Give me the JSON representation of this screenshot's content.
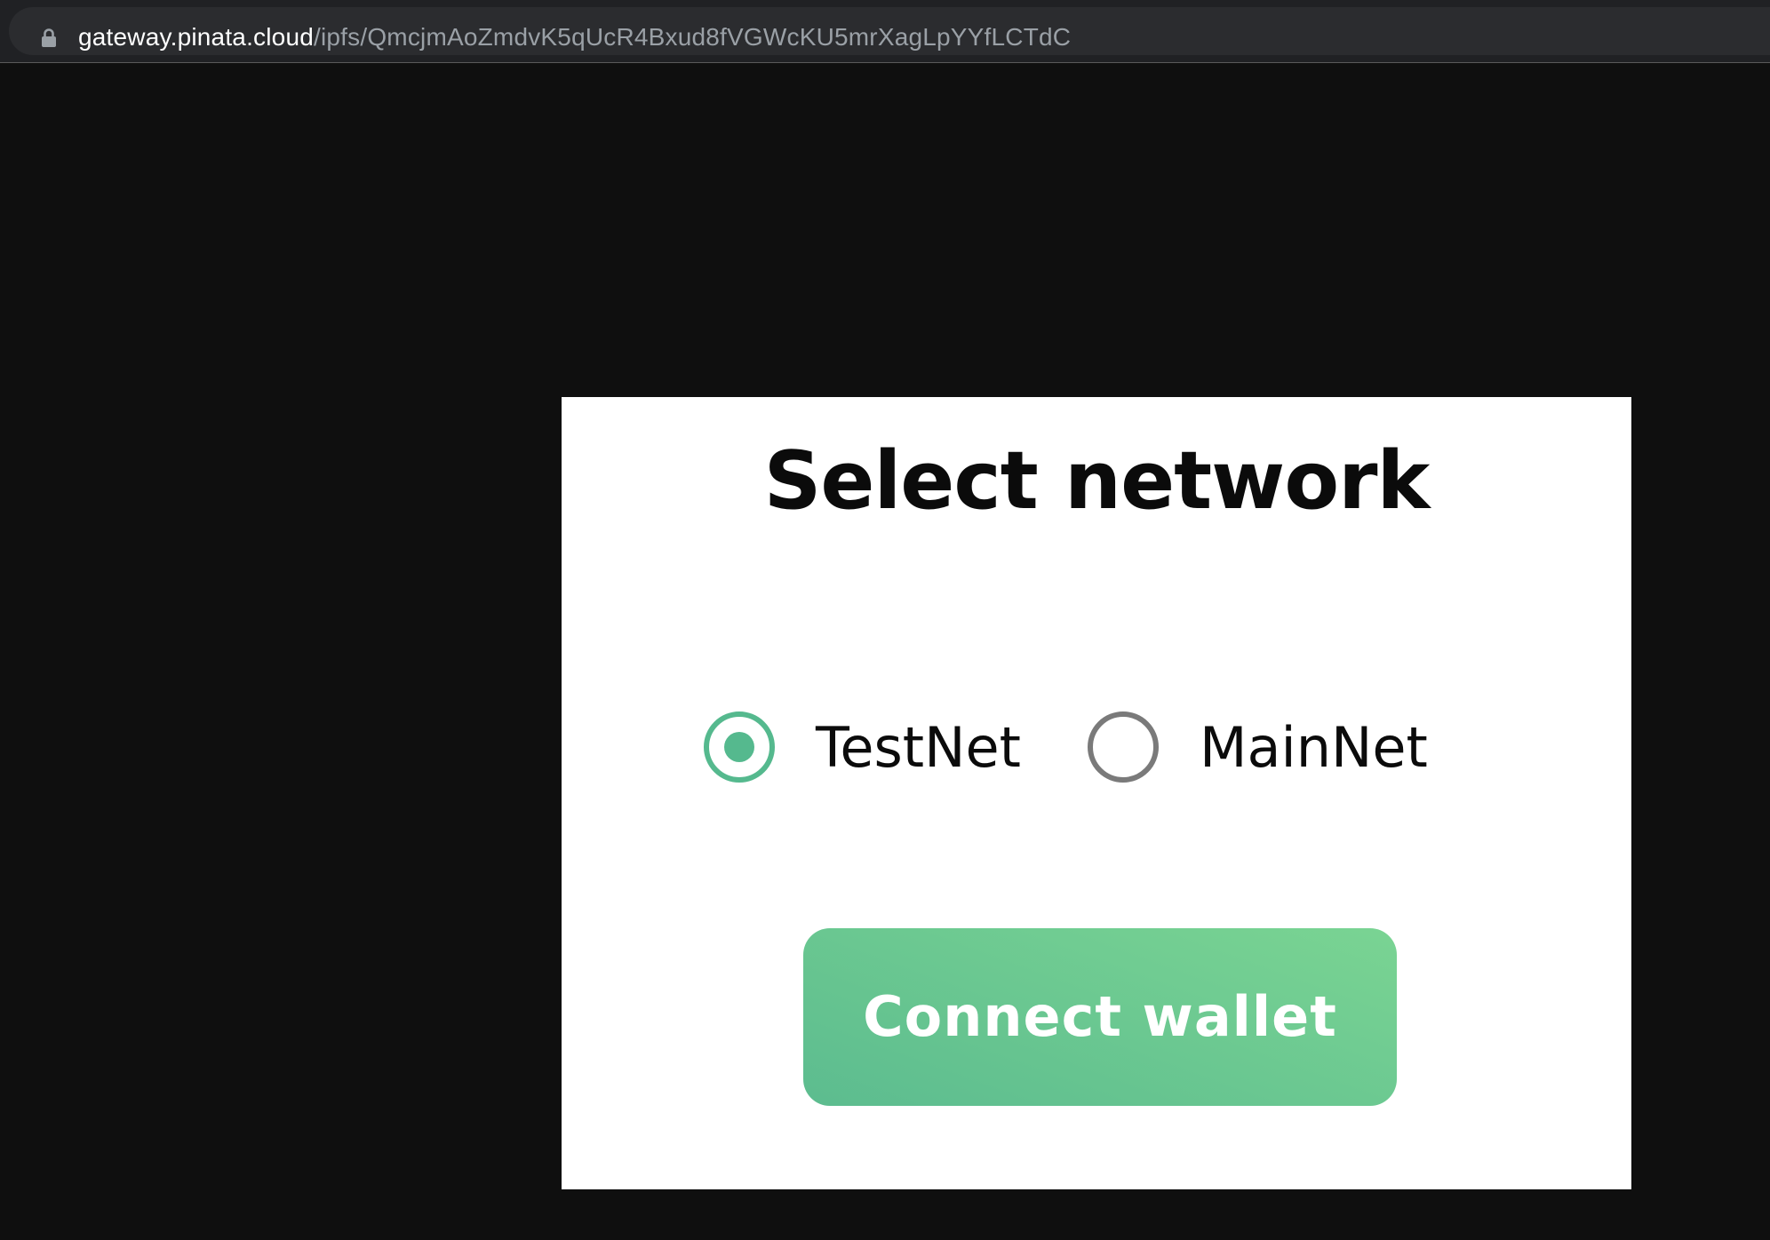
{
  "browser": {
    "url_host": "gateway.pinata.cloud",
    "url_path": "/ipfs/QmcjmAoZmdvK5qUcR4Bxud8fVGWcKU5mrXagLpYYfLCTdC",
    "lock_icon": "lock-icon"
  },
  "dialog": {
    "title": "Select network",
    "options": [
      {
        "label": "TestNet",
        "selected": true
      },
      {
        "label": "MainNet",
        "selected": false
      }
    ],
    "button_label": "Connect wallet"
  },
  "colors": {
    "accent": "#55b98e",
    "button_gradient_start": "#5cbc8f",
    "button_gradient_end": "#7ad493",
    "page_background": "#0f0f0f",
    "panel_background": "#ffffff"
  }
}
